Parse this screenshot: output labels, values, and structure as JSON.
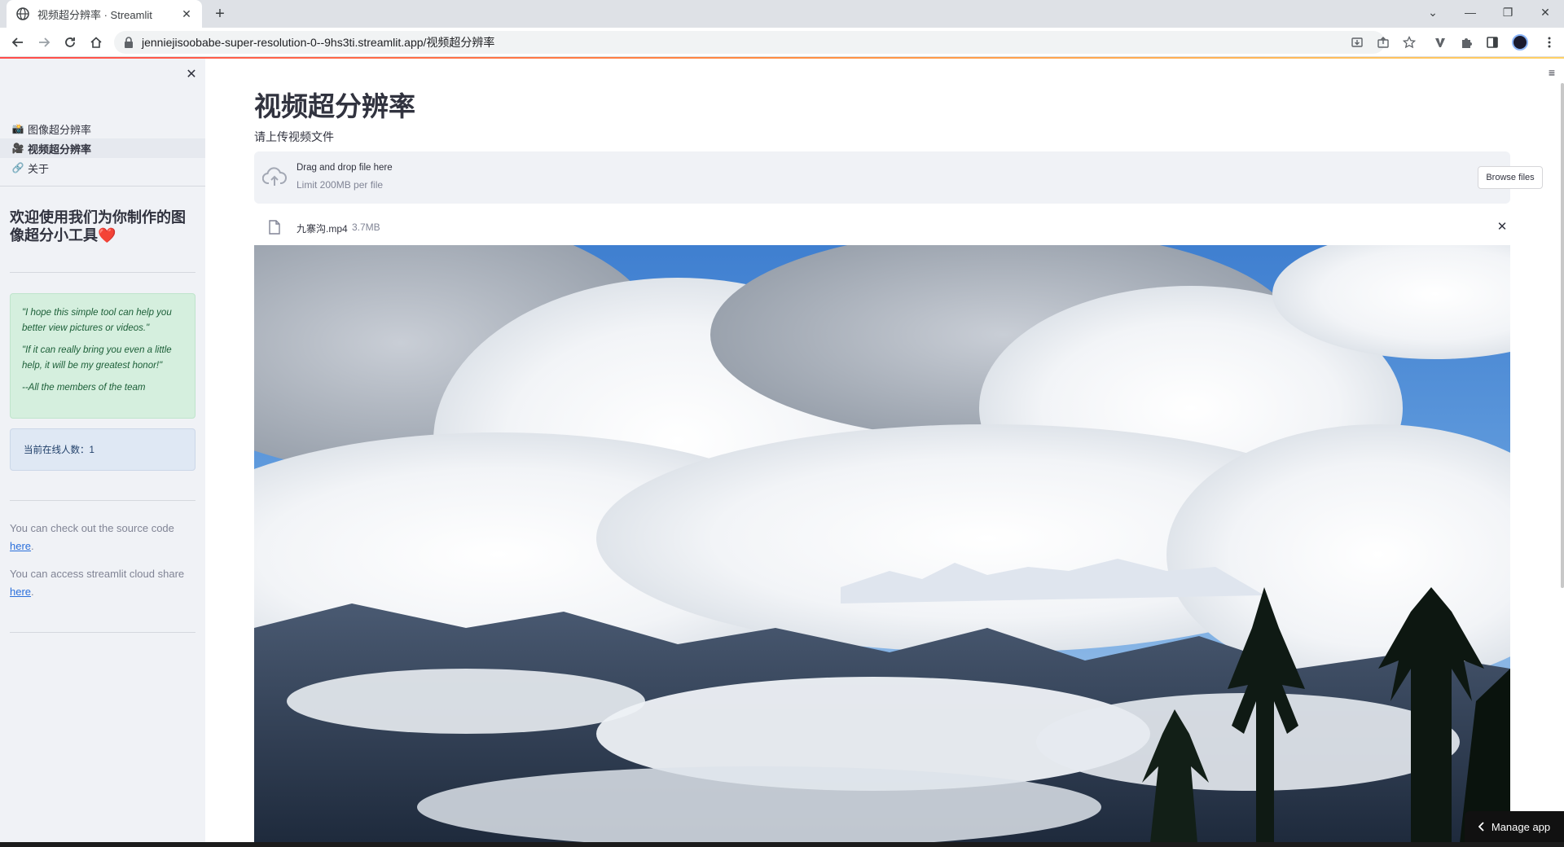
{
  "browser": {
    "tab_title": "视频超分辨率 · Streamlit",
    "url": "jenniejisoobabe-super-resolution-0--9hs3ti.streamlit.app/视频超分辨率"
  },
  "sidebar": {
    "nav": [
      {
        "icon": "📸",
        "label": "图像超分辨率",
        "active": false
      },
      {
        "icon": "🎥",
        "label": "视频超分辨率",
        "active": true
      },
      {
        "icon": "🔗",
        "label": "关于",
        "active": false
      }
    ],
    "heading": "欢迎使用我们为你制作的图像超分小工具",
    "heading_emoji": "❤️",
    "quotes": [
      "\"I hope this simple tool can help you better view pictures or videos.\"",
      "\"If it can really bring you even a little help, it will be my greatest honor!\"",
      "--All the members of the team"
    ],
    "online_text": "当前在线人数：1",
    "source_text": "You can check out the source code",
    "share_text": "You can access streamlit cloud share",
    "link_label": "here",
    "period": "."
  },
  "main": {
    "title": "视频超分辨率",
    "upload_label": "请上传视频文件",
    "dropzone_title": "Drag and drop file here",
    "dropzone_limit": "Limit 200MB per file",
    "browse_label": "Browse files",
    "file_name": "九寨沟.mp4",
    "file_size": "3.7MB"
  },
  "footer": {
    "manage_app": "Manage app"
  },
  "colors": {
    "accent": "#ff4b4b",
    "success_bg": "#d5efde",
    "info_bg": "#dfe8f4",
    "sidebar_bg": "#f0f2f6"
  }
}
